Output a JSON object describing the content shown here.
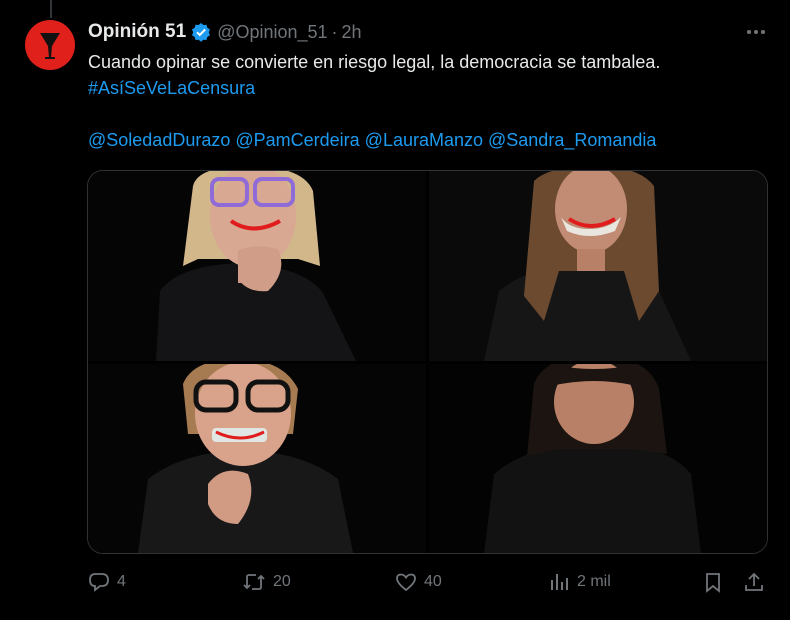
{
  "post": {
    "display_name": "Opinión 51",
    "handle": "@Opinion_51",
    "separator": "·",
    "time": "2h",
    "text_line1": "Cuando opinar se convierte en riesgo legal, la democracia se tambalea.",
    "hashtag": "#AsíSeVeLaCensura",
    "mentions": "@SoledadDurazo @PamCerdeira @LauraManzo  @Sandra_Romandia"
  },
  "actions": {
    "replies": "4",
    "reposts": "20",
    "likes": "40",
    "views": "2 mil"
  },
  "colors": {
    "background": "#000000",
    "text": "#e7e9ea",
    "muted": "#71767b",
    "link": "#1d9bf0",
    "avatar": "#e0201b",
    "border": "#2f3336"
  },
  "icons": [
    "more-icon",
    "verified-badge-icon",
    "reply-icon",
    "repost-icon",
    "like-icon",
    "views-icon",
    "bookmark-icon",
    "share-icon"
  ]
}
